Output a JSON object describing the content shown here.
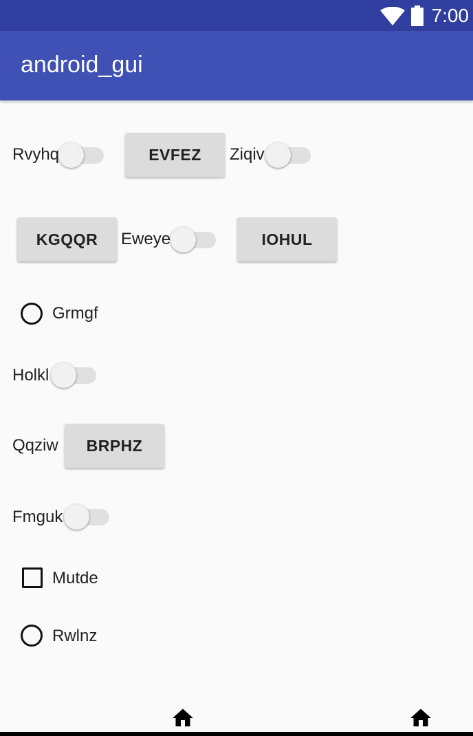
{
  "status_bar": {
    "time": "7:00"
  },
  "app_bar": {
    "title": "android_gui"
  },
  "widgets": {
    "switch_rvyhq": "Rvyhq",
    "button_evfez": "EVFEZ",
    "switch_ziqiv": "Ziqiv",
    "button_kgqqr": "KGQQR",
    "switch_eweye": "Eweye",
    "button_iohul": "IOHUL",
    "radio_grmgf": "Grmgf",
    "switch_holkl": "Holkl",
    "label_qqziw": "Qqziw",
    "button_brphz": "BRPHZ",
    "switch_fmguk": "Fmguk",
    "checkbox_mutde": "Mutde",
    "radio_rwlnz": "Rwlnz"
  },
  "icons": {
    "wifi": "wifi-icon",
    "battery": "battery-icon",
    "home": "home-icon"
  },
  "colors": {
    "status_bar": "#303f9f",
    "app_bar": "#3f51b5",
    "background": "#fafafa",
    "button": "#dcdcdc"
  }
}
